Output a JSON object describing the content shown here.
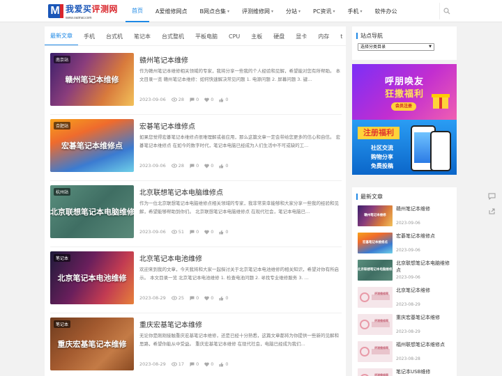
{
  "header": {
    "logo": {
      "cn_prefix": "我爱买",
      "cn_suffix": "评测网",
      "url": "www.oaimai.com",
      "letter": "M"
    },
    "nav": [
      {
        "label": "首页",
        "active": true,
        "caret": false
      },
      {
        "label": "A爱维修网点",
        "active": false,
        "caret": false
      },
      {
        "label": "B网点合集",
        "active": false,
        "caret": true
      },
      {
        "label": "评测维修网",
        "active": false,
        "caret": true
      },
      {
        "label": "分站",
        "active": false,
        "caret": true
      },
      {
        "label": "PC资讯",
        "active": false,
        "caret": true
      },
      {
        "label": "手机",
        "active": false,
        "caret": true
      },
      {
        "label": "软件办公",
        "active": false,
        "caret": false
      }
    ],
    "caret_glyph": "▾"
  },
  "tabs": [
    "最新文章",
    "手机",
    "台式机",
    "笔记本",
    "台式整机",
    "平板电脑",
    "CPU",
    "主板",
    "硬盘",
    "显卡",
    "内存",
    "t"
  ],
  "posts": [
    {
      "tag": "南京站",
      "thumb_title": "赣州笔记本维修",
      "title": "赣州笔记本维修",
      "excerpt": "作为赣州笔记本维修相关领域的专家，我将分享一些我的个人经验和见解，希望能对您有所帮助。 本文目录一览 赣州笔记本维修：如何快速解决常见问题 1. 电源问题 2. 屏幕问题 3. 键...",
      "date": "2023-09-06",
      "views": "28",
      "comments": "0",
      "likes": "0",
      "up": "0"
    },
    {
      "tag": "合肥站",
      "thumb_title": "宏碁笔记本维修点",
      "title": "宏碁笔记本维修点",
      "excerpt": "如果您觉得宏碁笔记本维修点很难理解或者应用，那么这篇文章一定会带给您更多的信心和自信。 宏碁笔记本维修点 在如今的数字时代，笔记本电脑已经成为人们生活中不可或缺的工...",
      "date": "2023-09-06",
      "views": "28",
      "comments": "0",
      "likes": "0",
      "up": "0"
    },
    {
      "tag": "杭州站",
      "thumb_title": "北京联想笔记本电脑维修点",
      "title": "北京联想笔记本电脑维修点",
      "excerpt": "作为一位北京联想笔记本电脑维修点相关领域的专家，我非常荣幸能够和大家分享一些我的经验和见解，希望能够帮助到你们。 北京联想笔记本电脑维修点 在现代社会，笔记本电脑已...",
      "date": "2023-09-06",
      "views": "51",
      "comments": "0",
      "likes": "0",
      "up": "0"
    },
    {
      "tag": "笔记本",
      "thumb_title": "北京笔记本电池维修",
      "title": "北京笔记本电池维修",
      "excerpt": "欢迎来到我的文章，今天我将和大家一起探讨关于北京笔记本电池维修的相关知识，希望对你有所启示。 本文目录一览 北京笔记本电池维修 1. 检查电池问题 2. 寻找专业维修服务 3. ...",
      "date": "2023-08-29",
      "views": "25",
      "comments": "0",
      "likes": "0",
      "up": "0"
    },
    {
      "tag": "笔记本",
      "thumb_title": "重庆宏基笔记本维修",
      "title": "重庆宏基笔记本维修",
      "excerpt": "无论你是刚刚接触重庆宏基笔记本维修，还是已经十分熟悉，这篇文章都将为你提供一些新的见解和思路，希望你能从中受益。 重庆宏基笔记本维修 在现代社会，电脑已经成为我们...",
      "date": "2023-08-29",
      "views": "17",
      "comments": "0",
      "likes": "0",
      "up": "0"
    }
  ],
  "sidebar": {
    "nav_heading": "站点导航",
    "select_value": "选择分类目录",
    "ad1": {
      "line1": "呼朋唤友",
      "line2": "狂撒福利",
      "button": "会员注册"
    },
    "ad2": {
      "banner": "注册福利",
      "lines": [
        "社区交流",
        "购物分享",
        "免费投稿"
      ]
    },
    "recent_heading": "最新文章",
    "recent": [
      {
        "title": "赣州笔记本维修",
        "date": "2023-09-06",
        "thumb_text": "赣州笔记本维修",
        "style": "bg1"
      },
      {
        "title": "宏碁笔记本维修点",
        "date": "2023-09-06",
        "thumb_text": "宏碁笔记本维修点",
        "style": "bg2"
      },
      {
        "title": "北京联想笔记本电脑维修点",
        "date": "2023-09-06",
        "thumb_text": "北京联想笔记本电脑维修点",
        "style": "bg3"
      },
      {
        "title": "北京笔记本维修",
        "date": "2023-08-29",
        "thumb_text": "评测维修网",
        "style": "gray"
      },
      {
        "title": "重庆宏基笔记本维修",
        "date": "2023-08-29",
        "thumb_text": "评测维修网",
        "style": "gray"
      },
      {
        "title": "福州联想笔记本维修点",
        "date": "2023-08-28",
        "thumb_text": "评测维修网",
        "style": "gray"
      },
      {
        "title": "笔记本USB维修",
        "date": "",
        "thumb_text": "评测维修网",
        "style": "gray"
      }
    ]
  },
  "colors": {
    "accent": "#1e88e5",
    "logo_blue": "#1a56b8",
    "logo_red": "#d9262c"
  }
}
